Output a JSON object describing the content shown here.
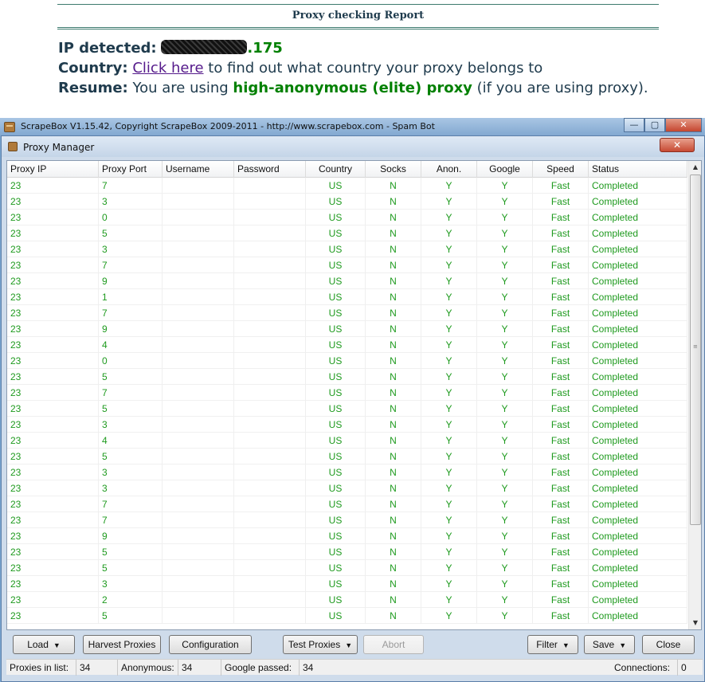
{
  "report": {
    "title": "Proxy checking Report",
    "ip_label": "IP detected:",
    "ip_suffix": ".175",
    "country_label": "Country:",
    "country_link": "Click here",
    "country_text": " to find out what country your proxy belongs to",
    "resume_label": "Resume:",
    "resume_text_1": " You are using ",
    "resume_highlight": "high-anonymous (elite) proxy",
    "resume_text_2": " (if you are using proxy)."
  },
  "app_window": {
    "title": "ScrapeBox V1.15.42, Copyright ScrapeBox 2009-2011 - http://www.scrapebox.com - Spam Bot",
    "minimize_glyph": "—",
    "maximize_glyph": "▢",
    "close_glyph": "✕"
  },
  "proxy_manager": {
    "title": "Proxy Manager",
    "close_glyph": "✕",
    "columns": [
      "Proxy IP",
      "Proxy Port",
      "Username",
      "Password",
      "Country",
      "Socks",
      "Anon.",
      "Google",
      "Speed",
      "Status"
    ],
    "rows": [
      [
        "23",
        "7",
        "US",
        "N",
        "Y",
        "Y",
        "Fast",
        "Completed"
      ],
      [
        "23",
        "3",
        "US",
        "N",
        "Y",
        "Y",
        "Fast",
        "Completed"
      ],
      [
        "23",
        "0",
        "US",
        "N",
        "Y",
        "Y",
        "Fast",
        "Completed"
      ],
      [
        "23",
        "5",
        "US",
        "N",
        "Y",
        "Y",
        "Fast",
        "Completed"
      ],
      [
        "23",
        "3",
        "US",
        "N",
        "Y",
        "Y",
        "Fast",
        "Completed"
      ],
      [
        "23",
        "7",
        "US",
        "N",
        "Y",
        "Y",
        "Fast",
        "Completed"
      ],
      [
        "23",
        "9",
        "US",
        "N",
        "Y",
        "Y",
        "Fast",
        "Completed"
      ],
      [
        "23",
        "1",
        "US",
        "N",
        "Y",
        "Y",
        "Fast",
        "Completed"
      ],
      [
        "23",
        "7",
        "US",
        "N",
        "Y",
        "Y",
        "Fast",
        "Completed"
      ],
      [
        "23",
        "9",
        "US",
        "N",
        "Y",
        "Y",
        "Fast",
        "Completed"
      ],
      [
        "23",
        "4",
        "US",
        "N",
        "Y",
        "Y",
        "Fast",
        "Completed"
      ],
      [
        "23",
        "0",
        "US",
        "N",
        "Y",
        "Y",
        "Fast",
        "Completed"
      ],
      [
        "23",
        "5",
        "US",
        "N",
        "Y",
        "Y",
        "Fast",
        "Completed"
      ],
      [
        "23",
        "7",
        "US",
        "N",
        "Y",
        "Y",
        "Fast",
        "Completed"
      ],
      [
        "23",
        "5",
        "US",
        "N",
        "Y",
        "Y",
        "Fast",
        "Completed"
      ],
      [
        "23",
        "3",
        "US",
        "N",
        "Y",
        "Y",
        "Fast",
        "Completed"
      ],
      [
        "23",
        "4",
        "US",
        "N",
        "Y",
        "Y",
        "Fast",
        "Completed"
      ],
      [
        "23",
        "5",
        "US",
        "N",
        "Y",
        "Y",
        "Fast",
        "Completed"
      ],
      [
        "23",
        "3",
        "US",
        "N",
        "Y",
        "Y",
        "Fast",
        "Completed"
      ],
      [
        "23",
        "3",
        "US",
        "N",
        "Y",
        "Y",
        "Fast",
        "Completed"
      ],
      [
        "23",
        "7",
        "US",
        "N",
        "Y",
        "Y",
        "Fast",
        "Completed"
      ],
      [
        "23",
        "7",
        "US",
        "N",
        "Y",
        "Y",
        "Fast",
        "Completed"
      ],
      [
        "23",
        "9",
        "US",
        "N",
        "Y",
        "Y",
        "Fast",
        "Completed"
      ],
      [
        "23",
        "5",
        "US",
        "N",
        "Y",
        "Y",
        "Fast",
        "Completed"
      ],
      [
        "23",
        "5",
        "US",
        "N",
        "Y",
        "Y",
        "Fast",
        "Completed"
      ],
      [
        "23",
        "3",
        "US",
        "N",
        "Y",
        "Y",
        "Fast",
        "Completed"
      ],
      [
        "23",
        "2",
        "US",
        "N",
        "Y",
        "Y",
        "Fast",
        "Completed"
      ],
      [
        "23",
        "5",
        "US",
        "N",
        "Y",
        "Y",
        "Fast",
        "Completed"
      ]
    ],
    "buttons": {
      "load": "Load",
      "harvest": "Harvest Proxies",
      "configuration": "Configuration",
      "test": "Test Proxies",
      "abort": "Abort",
      "filter": "Filter",
      "save": "Save",
      "close": "Close"
    },
    "status": {
      "proxies_label": "Proxies in list:",
      "proxies_value": "34",
      "anonymous_label": "Anonymous:",
      "anonymous_value": "34",
      "google_label": "Google passed:",
      "google_value": "34",
      "connections_label": "Connections:",
      "connections_value": "0"
    }
  },
  "colors": {
    "report_text": "#1f3b4d",
    "highlight_green": "#008000",
    "grid_text_green": "#1e9a1e",
    "link_purple": "#551a8b"
  }
}
